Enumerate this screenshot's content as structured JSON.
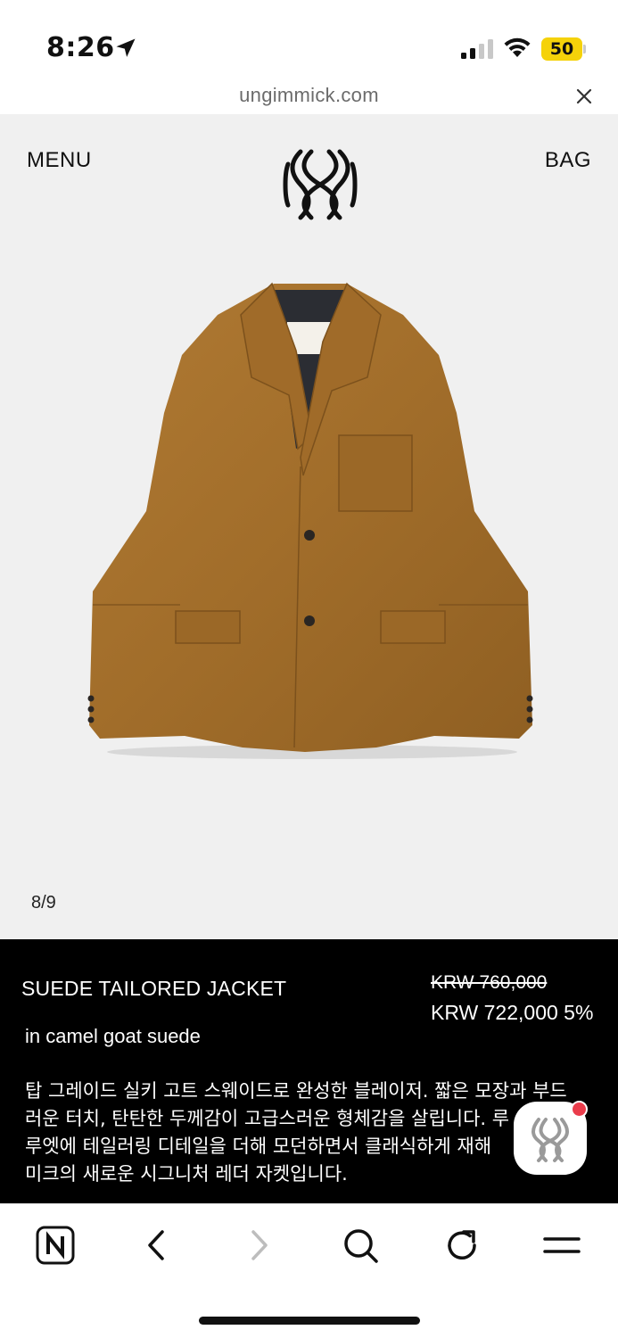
{
  "status_bar": {
    "time": "8:26",
    "battery_level": "50",
    "battery_color": "#f5d20a",
    "icons": [
      "location-arrow-icon",
      "signal-icon",
      "wifi-icon",
      "battery-icon"
    ]
  },
  "browser": {
    "url": "ungimmick.com",
    "close_icon": "close-icon"
  },
  "header": {
    "menu_label": "MENU",
    "bag_label": "BAG",
    "logo_icon": "brand-logo-icon"
  },
  "gallery": {
    "counter": "8/9",
    "image_icon": "suede-jacket-image"
  },
  "product": {
    "name": "SUEDE TAILORED JACKET",
    "original_price": "KRW 760,000",
    "sale_price": "KRW 722,000 5%",
    "variant": "in camel goat suede",
    "description": "탑 그레이드 실키 고트 스웨이드로 완성한 블레이저. 짧은 모장과 부드러운 터치, 탄탄한 두께감이 고급스러운 형체감을 살립니다. 루즈한 실루엣에 테일러링 디테일을 더해 모던하면서 클래식하게 재해석한 언기믹의 새로운 시그니처 레더 자켓입니다.",
    "description_lines": [
      "탑 그레이드 실키 고트 스웨이드로 완성한 블레이저. 짧은 모장과 부드",
      "러운 터치, 탄탄한 두께감이 고급스러운 형체감을 살립니다. 루",
      "루엣에 테일러링 디테일을 더해 모던하면서 클래식하게 재해",
      "미크의 새로운 시그니처 레더 자켓입니다."
    ]
  },
  "chat": {
    "icon": "chat-widget-icon",
    "badge_color": "#ea3c4b"
  },
  "toolbar": {
    "items": [
      "naver-home-icon",
      "back-arrow-icon",
      "forward-arrow-icon",
      "search-icon",
      "refresh-icon",
      "menu-icon"
    ]
  },
  "colors": {
    "viewer_bg": "#f0f0f0",
    "info_bg": "#000000",
    "jacket": "#a8742e"
  }
}
